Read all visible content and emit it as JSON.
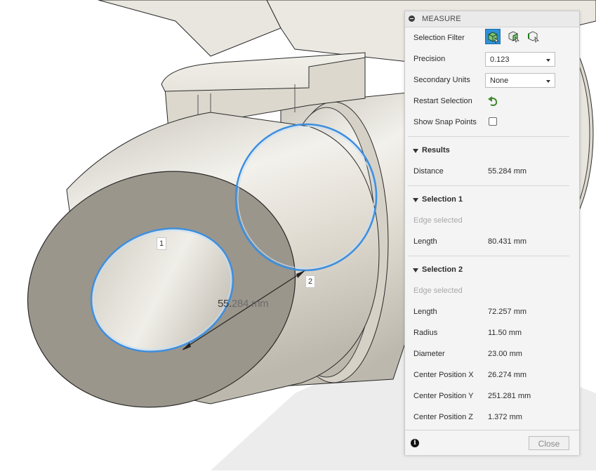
{
  "viewport": {
    "markers": [
      {
        "label": "1"
      },
      {
        "label": "2"
      }
    ],
    "dimension_visible": "55.",
    "dimension_faded": "284 mm"
  },
  "panel": {
    "title": "MEASURE",
    "selection_filter_label": "Selection Filter",
    "selection_filter_options": [
      "body-filter-icon",
      "face-filter-icon",
      "edge-filter-icon"
    ],
    "precision_label": "Precision",
    "precision_value": "0.123",
    "secondary_units_label": "Secondary Units",
    "secondary_units_value": "None",
    "restart_selection_label": "Restart Selection",
    "show_snap_points_label": "Show Snap Points",
    "show_snap_points_checked": false,
    "results": {
      "header": "Results",
      "distance_label": "Distance",
      "distance_value": "55.284 mm"
    },
    "selection1": {
      "header": "Selection 1",
      "status": "Edge selected",
      "length_label": "Length",
      "length_value": "80.431 mm"
    },
    "selection2": {
      "header": "Selection 2",
      "status": "Edge selected",
      "length_label": "Length",
      "length_value": "72.257 mm",
      "radius_label": "Radius",
      "radius_value": "11.50 mm",
      "diameter_label": "Diameter",
      "diameter_value": "23.00 mm",
      "cx_label": "Center Position X",
      "cx_value": "26.274 mm",
      "cy_label": "Center Position Y",
      "cy_value": "251.281 mm",
      "cz_label": "Center Position Z",
      "cz_value": "1.372 mm"
    },
    "close_label": "Close"
  },
  "colors": {
    "selection_highlight": "#3c8fe0",
    "active_filter": "#2f90d6",
    "model_body": "#e6e2d9",
    "end_face": "#9b968b"
  }
}
